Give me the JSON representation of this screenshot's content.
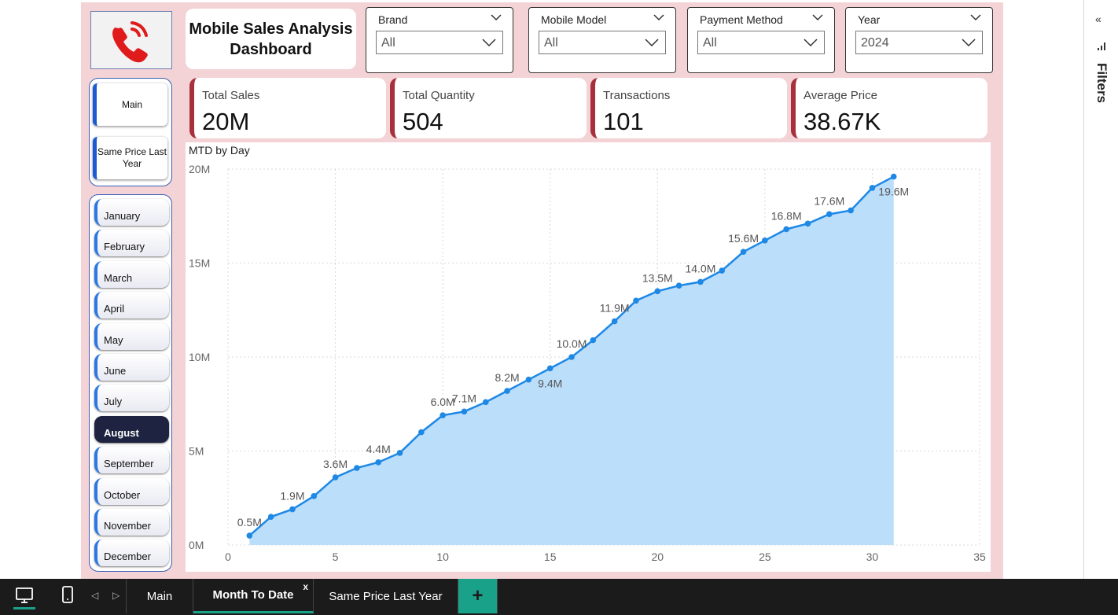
{
  "dashboard_title": "Mobile Sales Analysis Dashboard",
  "filters": [
    {
      "label": "Brand",
      "value": "All"
    },
    {
      "label": "Mobile Model",
      "value": "All"
    },
    {
      "label": "Payment Method",
      "value": "All"
    },
    {
      "label": "Year",
      "value": "2024"
    }
  ],
  "kpis": [
    {
      "title": "Total Sales",
      "value": "20M"
    },
    {
      "title": "Total Quantity",
      "value": "504"
    },
    {
      "title": "Transactions",
      "value": "101"
    },
    {
      "title": "Average Price",
      "value": "38.67K"
    }
  ],
  "nav": {
    "main": "Main",
    "same_price": "Same Price Last Year"
  },
  "months": [
    "January",
    "February",
    "March",
    "April",
    "May",
    "June",
    "July",
    "August",
    "September",
    "October",
    "November",
    "December"
  ],
  "active_month": "August",
  "filters_pane": {
    "label": "Filters"
  },
  "tabs": [
    "Main",
    "Month To Date",
    "Same Price Last Year"
  ],
  "active_tab": "Month To Date",
  "colors": {
    "accent": "#a8303c",
    "line": "#1e88e5",
    "area": "#bbdefb",
    "canvas": "#f4d3d6",
    "tab_active": "#1aa18a",
    "add_tab": "#1aa18a"
  },
  "chart_data": {
    "type": "area",
    "title": "MTD by Day",
    "xlim": [
      0,
      35
    ],
    "ylim": [
      0,
      20
    ],
    "xticks": [
      "0",
      "5",
      "10",
      "15",
      "20",
      "25",
      "30",
      "35"
    ],
    "yticks": [
      "0M",
      "5M",
      "10M",
      "15M",
      "20M"
    ],
    "grid": true,
    "x": [
      1,
      2,
      3,
      4,
      5,
      6,
      7,
      8,
      9,
      10,
      11,
      12,
      13,
      14,
      15,
      16,
      17,
      18,
      19,
      20,
      21,
      22,
      23,
      24,
      25,
      26,
      27,
      28,
      29,
      30,
      31
    ],
    "values": [
      0.5,
      1.5,
      1.9,
      2.6,
      3.6,
      4.1,
      4.4,
      4.9,
      6.0,
      6.9,
      7.1,
      7.6,
      8.2,
      8.8,
      9.4,
      10.0,
      10.9,
      11.9,
      13.0,
      13.5,
      13.8,
      14.0,
      14.6,
      15.6,
      16.2,
      16.8,
      17.1,
      17.6,
      17.8,
      19.0,
      19.6
    ],
    "data_labels": [
      {
        "x": 1,
        "text": "0.5M"
      },
      {
        "x": 3,
        "text": "1.9M"
      },
      {
        "x": 5,
        "text": "3.6M"
      },
      {
        "x": 7,
        "text": "4.4M"
      },
      {
        "x": 10,
        "text": "6.0M"
      },
      {
        "x": 11,
        "text": "7.1M"
      },
      {
        "x": 13,
        "text": "8.2M"
      },
      {
        "x": 15,
        "text": "9.4M"
      },
      {
        "x": 16,
        "text": "10.0M"
      },
      {
        "x": 18,
        "text": "11.9M"
      },
      {
        "x": 20,
        "text": "13.5M"
      },
      {
        "x": 22,
        "text": "14.0M"
      },
      {
        "x": 24,
        "text": "15.6M"
      },
      {
        "x": 26,
        "text": "16.8M"
      },
      {
        "x": 28,
        "text": "17.6M"
      },
      {
        "x": 31,
        "text": "19.6M"
      }
    ]
  }
}
